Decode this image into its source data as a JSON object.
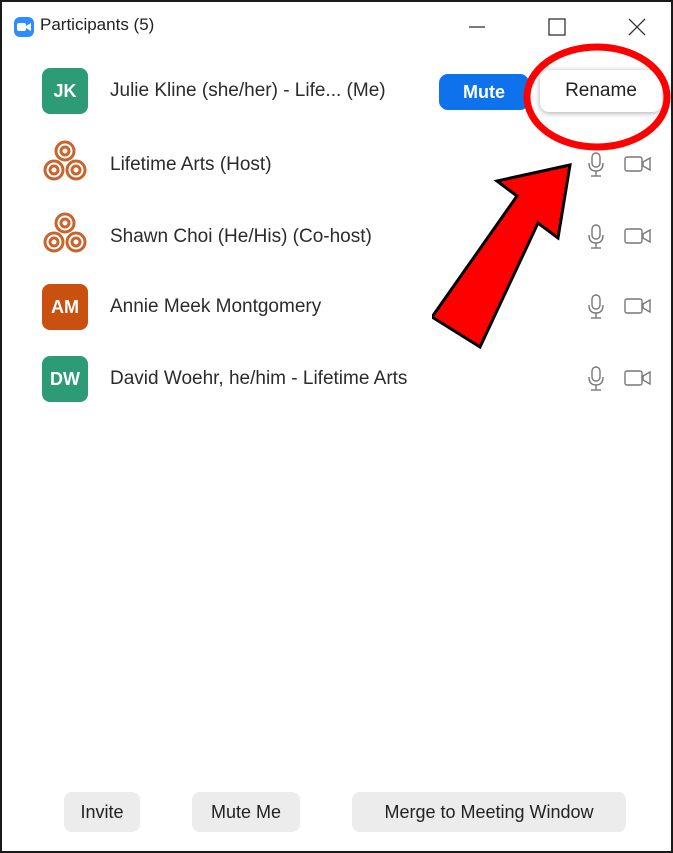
{
  "window": {
    "title": "Participants (5)",
    "controls": {
      "minimize_icon": "minimize-icon",
      "maximize_icon": "maximize-icon",
      "close_icon": "close-icon"
    }
  },
  "participants": [
    {
      "initials": "JK",
      "name": "Julie Kline (she/her) - Life... (Me)",
      "avatar_color": "#2e9b77",
      "avatar_type": "initials"
    },
    {
      "initials": "",
      "name": "Lifetime Arts (Host)",
      "avatar_color": "#c8652e",
      "avatar_type": "logo"
    },
    {
      "initials": "",
      "name": "Shawn Choi (He/His) (Co-host)",
      "avatar_color": "#c8652e",
      "avatar_type": "logo"
    },
    {
      "initials": "AM",
      "name": "Annie Meek Montgomery",
      "avatar_color": "#c9500e",
      "avatar_type": "initials"
    },
    {
      "initials": "DW",
      "name": "David Woehr, he/him - Lifetime Arts",
      "avatar_color": "#2e9b77",
      "avatar_type": "initials"
    }
  ],
  "row_actions": {
    "mute_label": "Mute",
    "rename_label": "Rename"
  },
  "footer": {
    "invite_label": "Invite",
    "mute_me_label": "Mute Me",
    "merge_label": "Merge to Meeting Window"
  },
  "colors": {
    "accent": "#0e72ed",
    "annotation": "#ff0000"
  }
}
